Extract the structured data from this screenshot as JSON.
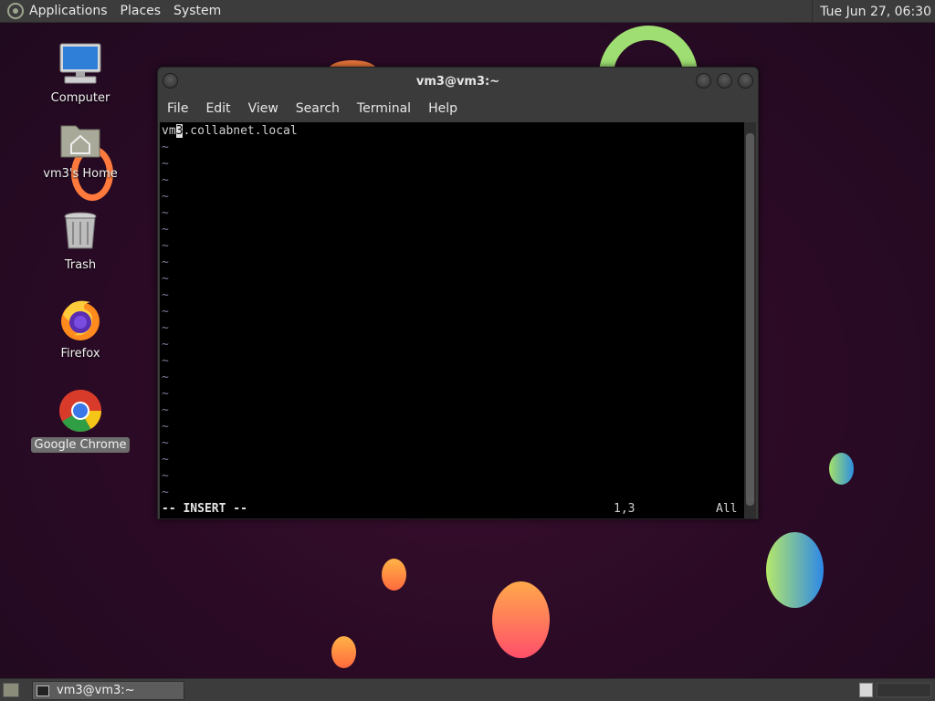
{
  "top_panel": {
    "menus": [
      "Applications",
      "Places",
      "System"
    ],
    "clock": "Tue Jun 27, 06:30"
  },
  "desktop_icons": [
    {
      "label": "Computer",
      "icon": "computer-icon"
    },
    {
      "label": "vm3's Home",
      "icon": "home-folder-icon"
    },
    {
      "label": "Trash",
      "icon": "trash-icon"
    },
    {
      "label": "Firefox",
      "icon": "firefox-icon"
    },
    {
      "label": "Google Chrome",
      "icon": "chrome-icon",
      "selected": true
    }
  ],
  "terminal": {
    "title": "vm3@vm3:~",
    "menus": [
      "File",
      "Edit",
      "View",
      "Search",
      "Terminal",
      "Help"
    ],
    "content": {
      "line_before_cursor": "vm",
      "cursor_char": "3",
      "line_after_cursor": ".collabnet.local",
      "tilde": "~"
    },
    "status": {
      "mode": "-- INSERT --",
      "position": "1,3",
      "scroll": "All"
    }
  },
  "taskbar": {
    "window_button_label": "vm3@vm3:~"
  },
  "colors": {
    "panel": "#3c3c3c",
    "terminal_bg": "#000000",
    "wallpaper": "#2a0a25"
  }
}
